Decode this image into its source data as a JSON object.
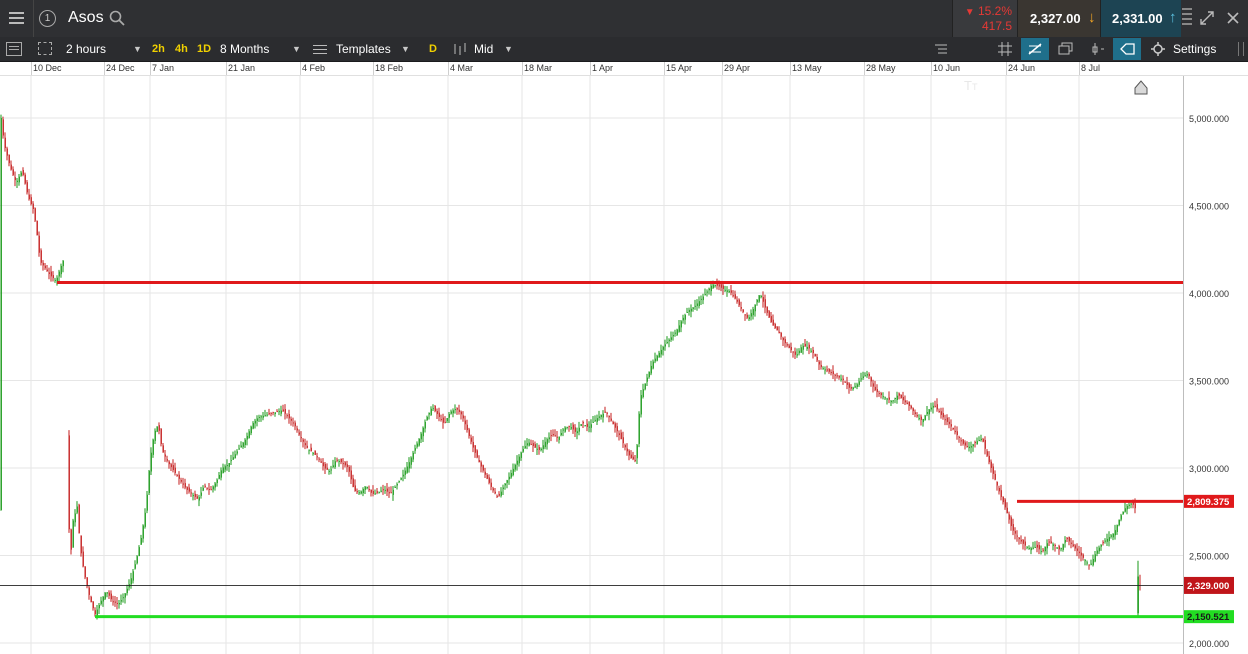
{
  "header": {
    "menu_icon": "hamburger-icon",
    "info_icon": "info-circle-icon",
    "title": "Asos",
    "search_icon": "search-icon",
    "change_percent": "15.2%",
    "change_value": "417.5",
    "change_arrow": "▼",
    "sell_price": "2,327.00",
    "buy_price": "2,331.00",
    "sell_arrow": "↓",
    "buy_arrow": "↑",
    "colors": {
      "down": "#e53935",
      "sell_bg": "#3a3631",
      "buy_bg": "#1d4453",
      "sell_arrow": "#f5a623",
      "buy_arrow": "#5bc0de"
    }
  },
  "toolbar": {
    "interval": "2 hours",
    "quick_intervals": [
      "2h",
      "4h",
      "1D"
    ],
    "range": "8 Months",
    "templates": "Templates",
    "d_button": "D",
    "price_type": "Mid",
    "settings": "Settings",
    "icons": [
      "chart-type-icon",
      "layout-icon",
      "text-size-icon",
      "crosshair-icon",
      "drawing-tools-icon",
      "windows-icon",
      "indicators-icon",
      "annotation-icon",
      "settings-gear-icon"
    ]
  },
  "x_axis": {
    "labels": [
      "10 Dec",
      "24 Dec",
      "7 Jan",
      "21 Jan",
      "4 Feb",
      "18 Feb",
      "4 Mar",
      "18 Mar",
      "1 Apr",
      "15 Apr",
      "29 Apr",
      "13 May",
      "28 May",
      "10 Jun",
      "24 Jun",
      "8 Jul"
    ]
  },
  "y_axis": {
    "labels": [
      "5,000.000",
      "4,500.000",
      "4,000.000",
      "3,500.000",
      "3,000.000",
      "2,500.000",
      "2,000.000"
    ]
  },
  "markers": {
    "resistance_upper": "4,060",
    "resistance_lower": "2,809.375",
    "current_price": "2,329.000",
    "support": "2,150.521",
    "colors": {
      "resistance": "#e0191b",
      "support": "#22dd22",
      "current": "#c0151a"
    }
  },
  "chart_data": {
    "type": "candlestick",
    "title": "Asos",
    "timeframe": "2 hours",
    "range": "8 Months",
    "x": [
      "10 Dec",
      "24 Dec",
      "7 Jan",
      "21 Jan",
      "4 Feb",
      "18 Feb",
      "4 Mar",
      "18 Mar",
      "1 Apr",
      "15 Apr",
      "29 Apr",
      "13 May",
      "28 May",
      "10 Jun",
      "24 Jun",
      "8 Jul"
    ],
    "approx_close": [
      4650,
      2250,
      3150,
      3150,
      3100,
      2850,
      3350,
      2900,
      3250,
      3600,
      4050,
      3800,
      3500,
      3300,
      2650,
      2750
    ],
    "ylim": [
      1970,
      5200
    ],
    "y_ticks": [
      5000,
      4500,
      4000,
      3500,
      3000,
      2500,
      2000
    ],
    "horizontal_lines": [
      {
        "name": "resistance",
        "value": 4060
      },
      {
        "name": "resistance",
        "value": 2809.375
      },
      {
        "name": "current",
        "value": 2329
      },
      {
        "name": "support",
        "value": 2150.521
      }
    ],
    "grid": true
  }
}
